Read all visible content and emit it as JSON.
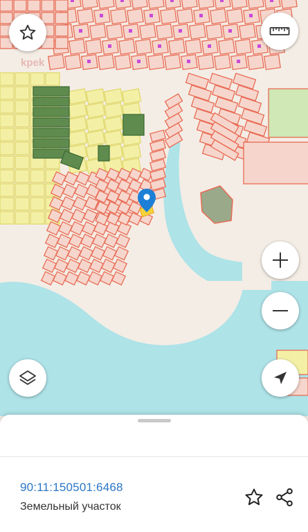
{
  "map": {
    "colors": {
      "land": "#f4ede5",
      "water": "#aee3e8",
      "parcel_outline": "#e86b55",
      "parcel_fill": "#f6d6cc",
      "yellow_parcel_fill": "#f3f0a6",
      "yellow_parcel_outline": "#e1d86a",
      "green_parcel_fill": "#5f8c4e",
      "poi_marker": "#c84bd8",
      "pin": "#1d7fd6",
      "selected_parcel": "#f5d23a"
    },
    "watermark": "kpek"
  },
  "controls": {
    "favorite_icon": "star-icon",
    "ruler_icon": "ruler-icon",
    "zoom_in_icon": "plus-icon",
    "zoom_out_icon": "minus-icon",
    "layers_icon": "layers-icon",
    "locate_icon": "navigation-arrow-icon"
  },
  "parcel": {
    "cadastral_number": "90:11:150501:6468",
    "type": "Земельный участок",
    "favorite_icon": "star-outline-icon",
    "share_icon": "share-icon"
  }
}
